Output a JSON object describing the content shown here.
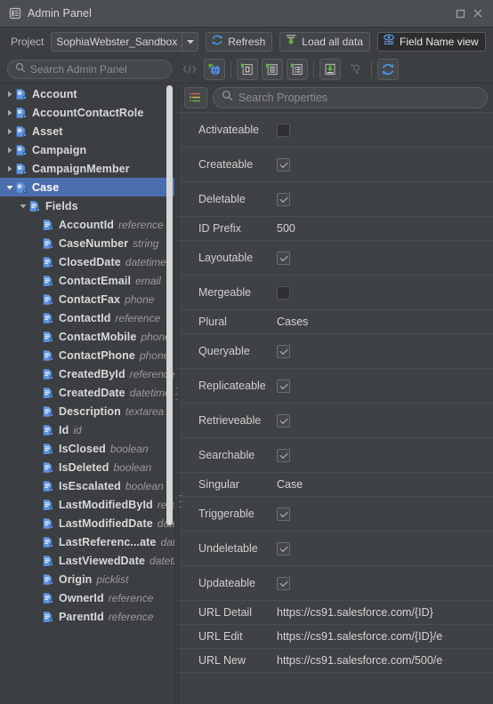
{
  "window": {
    "title": "Admin Panel",
    "icon": "panel-icon",
    "restore_label": "□",
    "close_label": "✕"
  },
  "toolbar": {
    "project_label": "Project",
    "project_value": "SophiaWebster_Sandbox",
    "refresh_label": "Refresh",
    "load_all_label": "Load all data",
    "field_name_view_label": "Field Name view",
    "field_name_view_active": true
  },
  "search": {
    "placeholder": "Search Admin Panel"
  },
  "icon_strip": [
    {
      "name": "code-view-icon",
      "framed": false,
      "disabled": true
    },
    {
      "name": "globe-refresh-icon",
      "framed": true,
      "disabled": false
    },
    {
      "name": "separator",
      "framed": false,
      "disabled": false
    },
    {
      "name": "object-describe-icon",
      "framed": true,
      "disabled": false
    },
    {
      "name": "layout-describe-icon",
      "framed": true,
      "disabled": false
    },
    {
      "name": "list-describe-icon",
      "framed": true,
      "disabled": false
    },
    {
      "name": "separator",
      "framed": false,
      "disabled": false
    },
    {
      "name": "download-data-icon",
      "framed": true,
      "disabled": false
    },
    {
      "name": "add-key-icon",
      "framed": false,
      "disabled": true
    },
    {
      "name": "separator",
      "framed": false,
      "disabled": false
    },
    {
      "name": "sync-refresh-icon",
      "framed": true,
      "disabled": false
    }
  ],
  "tree": [
    {
      "label": "Account",
      "type": "",
      "kind": "object",
      "depth": 0,
      "twist": "collapsed",
      "selected": false
    },
    {
      "label": "AccountContactRole",
      "type": "",
      "kind": "object",
      "depth": 0,
      "twist": "collapsed",
      "selected": false
    },
    {
      "label": "Asset",
      "type": "",
      "kind": "object",
      "depth": 0,
      "twist": "collapsed",
      "selected": false
    },
    {
      "label": "Campaign",
      "type": "",
      "kind": "object",
      "depth": 0,
      "twist": "collapsed",
      "selected": false
    },
    {
      "label": "CampaignMember",
      "type": "",
      "kind": "object",
      "depth": 0,
      "twist": "collapsed",
      "selected": false
    },
    {
      "label": "Case",
      "type": "",
      "kind": "object",
      "depth": 0,
      "twist": "expanded",
      "selected": true
    },
    {
      "label": "Fields",
      "type": "",
      "kind": "folder",
      "depth": 1,
      "twist": "expanded",
      "selected": false
    },
    {
      "label": "AccountId",
      "type": "reference",
      "kind": "field",
      "depth": 2,
      "twist": "none",
      "selected": false
    },
    {
      "label": "CaseNumber",
      "type": "string",
      "kind": "field",
      "depth": 2,
      "twist": "none",
      "selected": false
    },
    {
      "label": "ClosedDate",
      "type": "datetime",
      "kind": "field",
      "depth": 2,
      "twist": "none",
      "selected": false
    },
    {
      "label": "ContactEmail",
      "type": "email",
      "kind": "field",
      "depth": 2,
      "twist": "none",
      "selected": false
    },
    {
      "label": "ContactFax",
      "type": "phone",
      "kind": "field",
      "depth": 2,
      "twist": "none",
      "selected": false
    },
    {
      "label": "ContactId",
      "type": "reference",
      "kind": "field",
      "depth": 2,
      "twist": "none",
      "selected": false
    },
    {
      "label": "ContactMobile",
      "type": "phone",
      "kind": "field",
      "depth": 2,
      "twist": "none",
      "selected": false
    },
    {
      "label": "ContactPhone",
      "type": "phone",
      "kind": "field",
      "depth": 2,
      "twist": "none",
      "selected": false
    },
    {
      "label": "CreatedById",
      "type": "reference",
      "kind": "field",
      "depth": 2,
      "twist": "none",
      "selected": false
    },
    {
      "label": "CreatedDate",
      "type": "datetime",
      "kind": "field",
      "depth": 2,
      "twist": "none",
      "selected": false
    },
    {
      "label": "Description",
      "type": "textarea",
      "kind": "field",
      "depth": 2,
      "twist": "none",
      "selected": false
    },
    {
      "label": "Id",
      "type": "id",
      "kind": "field",
      "depth": 2,
      "twist": "none",
      "selected": false
    },
    {
      "label": "IsClosed",
      "type": "boolean",
      "kind": "field",
      "depth": 2,
      "twist": "none",
      "selected": false
    },
    {
      "label": "IsDeleted",
      "type": "boolean",
      "kind": "field",
      "depth": 2,
      "twist": "none",
      "selected": false
    },
    {
      "label": "IsEscalated",
      "type": "boolean",
      "kind": "field",
      "depth": 2,
      "twist": "none",
      "selected": false
    },
    {
      "label": "LastModifiedById",
      "type": "reference",
      "kind": "field",
      "depth": 2,
      "twist": "none",
      "selected": false
    },
    {
      "label": "LastModifiedDate",
      "type": "datetime",
      "kind": "field",
      "depth": 2,
      "twist": "none",
      "selected": false
    },
    {
      "label": "LastReferenc...ate",
      "type": "datetime",
      "kind": "field",
      "depth": 2,
      "twist": "none",
      "selected": false
    },
    {
      "label": "LastViewedDate",
      "type": "datetime",
      "kind": "field",
      "depth": 2,
      "twist": "none",
      "selected": false
    },
    {
      "label": "Origin",
      "type": "picklist",
      "kind": "field",
      "depth": 2,
      "twist": "none",
      "selected": false
    },
    {
      "label": "OwnerId",
      "type": "reference",
      "kind": "field",
      "depth": 2,
      "twist": "none",
      "selected": false
    },
    {
      "label": "ParentId",
      "type": "reference",
      "kind": "field",
      "depth": 2,
      "twist": "none",
      "selected": false
    }
  ],
  "properties": {
    "header_icon": "properties-list-icon",
    "search_placeholder": "Search Properties",
    "rows": [
      {
        "key": "Activateable",
        "type": "checkbox",
        "checked": false
      },
      {
        "key": "Createable",
        "type": "checkbox",
        "checked": true
      },
      {
        "key": "Deletable",
        "type": "checkbox",
        "checked": true
      },
      {
        "key": "ID Prefix",
        "type": "text",
        "value": "500"
      },
      {
        "key": "Layoutable",
        "type": "checkbox",
        "checked": true
      },
      {
        "key": "Mergeable",
        "type": "checkbox",
        "checked": false
      },
      {
        "key": "Plural",
        "type": "text",
        "value": "Cases"
      },
      {
        "key": "Queryable",
        "type": "checkbox",
        "checked": true
      },
      {
        "key": "Replicateable",
        "type": "checkbox",
        "checked": true
      },
      {
        "key": "Retrieveable",
        "type": "checkbox",
        "checked": true
      },
      {
        "key": "Searchable",
        "type": "checkbox",
        "checked": true
      },
      {
        "key": "Singular",
        "type": "text",
        "value": "Case"
      },
      {
        "key": "Triggerable",
        "type": "checkbox",
        "checked": true
      },
      {
        "key": "Undeletable",
        "type": "checkbox",
        "checked": true
      },
      {
        "key": "Updateable",
        "type": "checkbox",
        "checked": true
      },
      {
        "key": "URL Detail",
        "type": "text",
        "value": "https://cs91.salesforce.com/{ID}"
      },
      {
        "key": "URL Edit",
        "type": "text",
        "value": "https://cs91.salesforce.com/{ID}/e"
      },
      {
        "key": "URL New",
        "type": "text",
        "value": "https://cs91.salesforce.com/500/e"
      }
    ]
  },
  "colors": {
    "window_bg": "#3c3f41",
    "titlebar_bg": "#4b4f51",
    "selection_blue": "#4b6eaf",
    "icon_blue": "#5c93e6",
    "icon_green": "#62b543",
    "text": "#d4d4d4",
    "muted_text": "#9a9a9a"
  }
}
